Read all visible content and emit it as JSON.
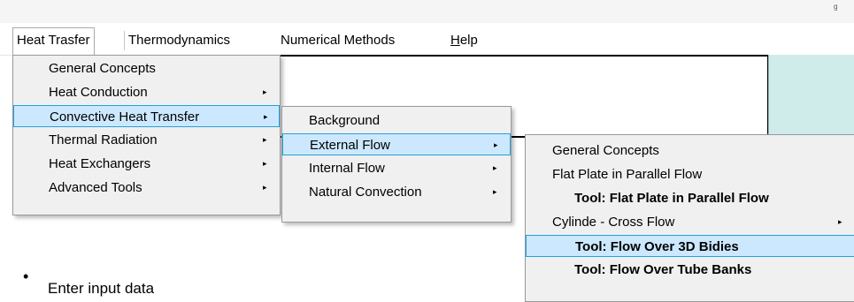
{
  "menubar": {
    "items": [
      {
        "label": "Heat Trasfer"
      },
      {
        "label": "Thermodynamics"
      },
      {
        "label": "Numerical Methods"
      },
      {
        "label_prefix": "",
        "label_underlined": "H",
        "label_rest": "elp"
      }
    ],
    "top_right_glyph": "ᵍ"
  },
  "menu1": {
    "items": [
      {
        "label": "General Concepts",
        "has_submenu": false
      },
      {
        "label": "Heat Conduction",
        "has_submenu": true
      },
      {
        "label": "Convective Heat Transfer",
        "has_submenu": true,
        "selected": true
      },
      {
        "label": "Thermal Radiation",
        "has_submenu": true
      },
      {
        "label": "Heat Exchangers",
        "has_submenu": true
      },
      {
        "label": "Advanced Tools",
        "has_submenu": true
      }
    ]
  },
  "menu2": {
    "items": [
      {
        "label": "Background",
        "has_submenu": false
      },
      {
        "label": "External Flow",
        "has_submenu": true,
        "selected": true
      },
      {
        "label": "Internal Flow",
        "has_submenu": true
      },
      {
        "label": "Natural Convection",
        "has_submenu": true
      }
    ]
  },
  "menu3": {
    "items": [
      {
        "label": "General Concepts"
      },
      {
        "label": "Flat Plate in Parallel Flow"
      },
      {
        "label": "Tool: Flat Plate in Parallel Flow",
        "bold": true
      },
      {
        "label": "Cylinde - Cross Flow",
        "has_submenu": true
      },
      {
        "label": "Tool: Flow Over 3D Bidies",
        "bold": true,
        "selected": true
      },
      {
        "label": "Tool: Flow Over Tube Banks",
        "bold": true
      }
    ]
  },
  "icons": {
    "submenu_arrow": "▸",
    "bullet": "•"
  },
  "document": {
    "bullet_text": "Enter input data"
  },
  "colors": {
    "highlight_bg": "#cce8ff",
    "highlight_border": "#26a0da",
    "teal_panel": "#d0ecea",
    "menu_bg": "#f0f0f0"
  }
}
